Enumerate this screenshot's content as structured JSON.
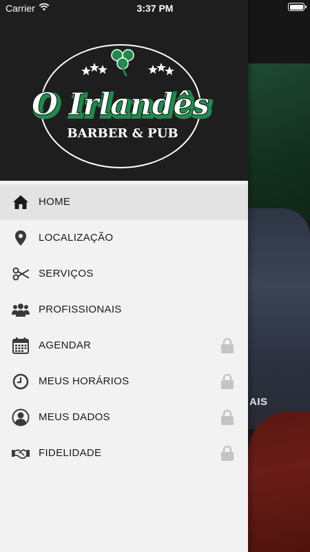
{
  "status_bar": {
    "carrier": "Carrier",
    "time": "3:37 PM"
  },
  "brand": {
    "name": "O Irlandês",
    "tagline": "BARBER & PUB",
    "green": "#1f8a4c"
  },
  "menu": {
    "items": [
      {
        "label": "HOME",
        "icon": "home-icon",
        "active": true,
        "locked": false
      },
      {
        "label": "LOCALIZAÇÃO",
        "icon": "location-pin-icon",
        "active": false,
        "locked": false
      },
      {
        "label": "SERVIÇOS",
        "icon": "scissors-icon",
        "active": false,
        "locked": false
      },
      {
        "label": "PROFISSIONAIS",
        "icon": "group-icon",
        "active": false,
        "locked": false
      },
      {
        "label": "AGENDAR",
        "icon": "calendar-icon",
        "active": false,
        "locked": true
      },
      {
        "label": "MEUS HORÁRIOS",
        "icon": "clock-icon",
        "active": false,
        "locked": true
      },
      {
        "label": "MEUS DADOS",
        "icon": "user-icon",
        "active": false,
        "locked": true
      },
      {
        "label": "FIDELIDADE",
        "icon": "handshake-icon",
        "active": false,
        "locked": true
      }
    ]
  },
  "background": {
    "visible_text": "AIS"
  }
}
